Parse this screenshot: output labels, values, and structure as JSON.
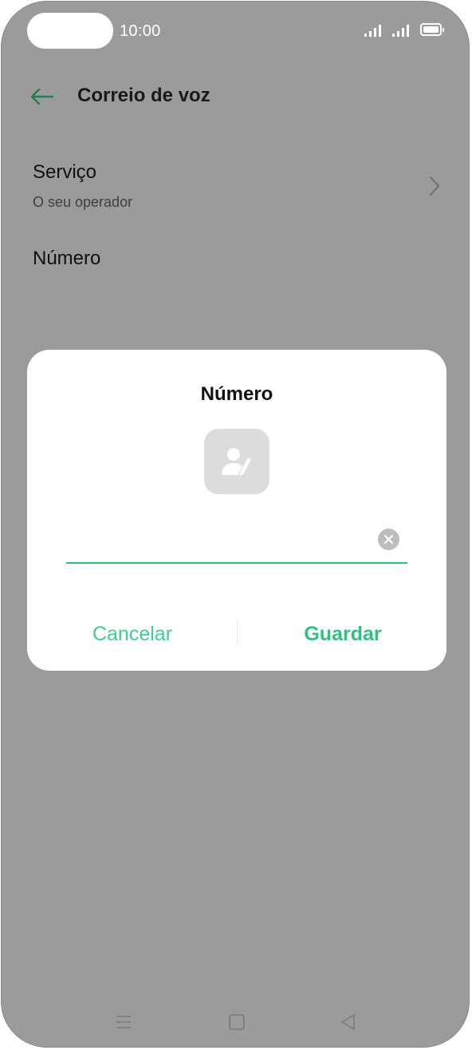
{
  "status_bar": {
    "time": "10:00",
    "icons": [
      "signal-icon",
      "signal-icon",
      "battery-icon"
    ]
  },
  "header": {
    "back_icon": "arrow-left-icon",
    "title": "Correio de voz"
  },
  "settings": {
    "service": {
      "label": "Serviço",
      "value": "O seu operador",
      "icon": "chevron-right-icon"
    },
    "number": {
      "label": "Número"
    }
  },
  "dialog": {
    "title": "Número",
    "contact_icon": "contact-edit-icon",
    "input_value": "",
    "input_placeholder": "",
    "clear_icon": "clear-icon",
    "cancel_label": "Cancelar",
    "save_label": "Guardar"
  },
  "nav_bar": {
    "icons": [
      "menu-icon",
      "home-icon",
      "back-triangle-icon"
    ]
  },
  "colors": {
    "accent": "#2ec27e",
    "scrim": "#9b9b9b",
    "dialog_bg": "#ffffff"
  }
}
